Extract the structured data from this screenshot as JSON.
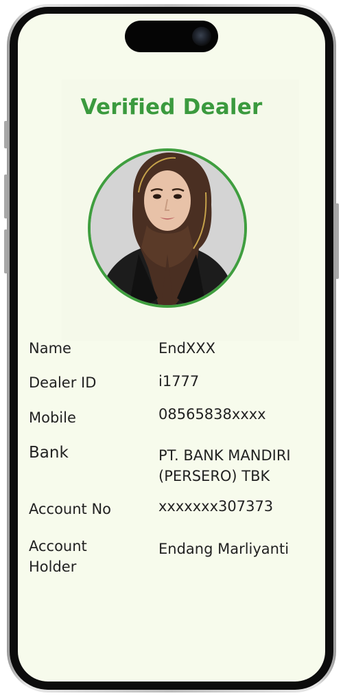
{
  "card": {
    "title": "Verified Dealer"
  },
  "fields": {
    "name": {
      "label": "Name",
      "value": "EndXXX"
    },
    "dealer_id": {
      "label": "Dealer ID",
      "value": "i1777"
    },
    "mobile": {
      "label": "Mobile",
      "value": "08565838xxxx"
    },
    "bank": {
      "label": "Bank",
      "value": "PT. BANK MANDIRI\n(PERSERO) TBK"
    },
    "account_no": {
      "label": "Account No",
      "value": "xxxxxxx307373"
    },
    "account_holder": {
      "label": "Account\nHolder",
      "value": "Endang Marliyanti"
    }
  },
  "colors": {
    "accent": "#3b9a3e",
    "screen_background": "#f7fbec",
    "text": "#222222"
  }
}
